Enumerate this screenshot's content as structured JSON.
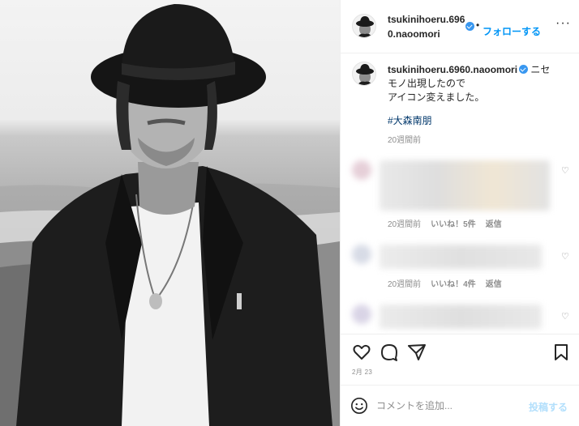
{
  "header": {
    "username": "tsukinihoeru.6960.naoomori",
    "dot": "•",
    "follow_label": "フォローする",
    "more": "···"
  },
  "caption": {
    "username": "tsukinihoeru.6960.naoomori",
    "text_line1": "ニセモノ出現したので",
    "text_line2": "アイコン変えました。",
    "hashtag": "#大森南朋",
    "time": "20週間前"
  },
  "comments": [
    {
      "time": "20週間前",
      "likes": "いいね！5件",
      "reply": "返信"
    },
    {
      "time": "20週間前",
      "likes": "いいね！4件",
      "reply": "返信"
    },
    {
      "time": "",
      "likes": "",
      "reply": ""
    }
  ],
  "post": {
    "date": "2月 23"
  },
  "comment_box": {
    "placeholder": "コメントを追加...",
    "post_label": "投稿する"
  },
  "icons": {
    "like": "heart-icon",
    "comment": "comment-icon",
    "share": "paper-plane-icon",
    "save": "bookmark-icon",
    "emoji": "emoji-icon"
  },
  "colors": {
    "accent": "#0095f6",
    "verified": "#3897f0",
    "hashtag": "#00376b",
    "muted": "#8e8e8e"
  }
}
